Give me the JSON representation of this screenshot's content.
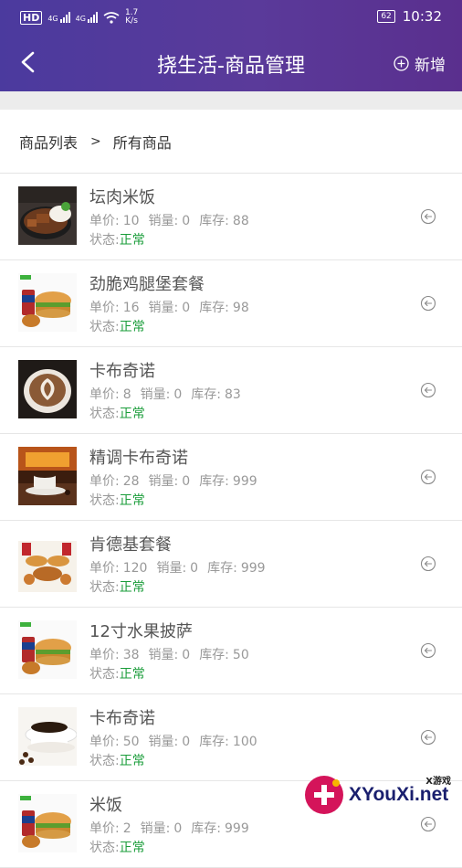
{
  "status_bar": {
    "network_badge": "HD",
    "signal1_label": "4G",
    "signal2_label": "4G",
    "speed_value": "1.7",
    "speed_unit": "K/s",
    "battery": "62",
    "time": "10:32"
  },
  "navbar": {
    "title": "挠生活-商品管理",
    "add_label": "新增"
  },
  "breadcrumb": {
    "root": "商品列表",
    "separator": ">",
    "current": "所有商品"
  },
  "labels": {
    "price": "单价:",
    "sales": "销量:",
    "stock": "库存:",
    "status": "状态:"
  },
  "products": [
    {
      "name": "坛肉米饭",
      "price": "10",
      "sales": "0",
      "stock": "88",
      "status": "正常",
      "image": "braised-pork-rice"
    },
    {
      "name": "劲脆鸡腿堡套餐",
      "price": "16",
      "sales": "0",
      "stock": "98",
      "status": "正常",
      "image": "burger-combo"
    },
    {
      "name": "卡布奇诺",
      "price": "8",
      "sales": "0",
      "stock": "83",
      "status": "正常",
      "image": "latte-art"
    },
    {
      "name": "精调卡布奇诺",
      "price": "28",
      "sales": "0",
      "stock": "999",
      "status": "正常",
      "image": "coffee-fireplace"
    },
    {
      "name": "肯德基套餐",
      "price": "120",
      "sales": "0",
      "stock": "999",
      "status": "正常",
      "image": "kfc-spread"
    },
    {
      "name": "12寸水果披萨",
      "price": "38",
      "sales": "0",
      "stock": "50",
      "status": "正常",
      "image": "burger-combo"
    },
    {
      "name": "卡布奇诺",
      "price": "50",
      "sales": "0",
      "stock": "100",
      "status": "正常",
      "image": "black-coffee"
    },
    {
      "name": "米饭",
      "price": "2",
      "sales": "0",
      "stock": "999",
      "status": "正常",
      "image": "burger-combo"
    }
  ],
  "watermark": {
    "brand": "XYouXi.net",
    "tag": "X游戏"
  },
  "colors": {
    "header": "#4b3a9e",
    "status_ok": "#1a9d3a"
  }
}
